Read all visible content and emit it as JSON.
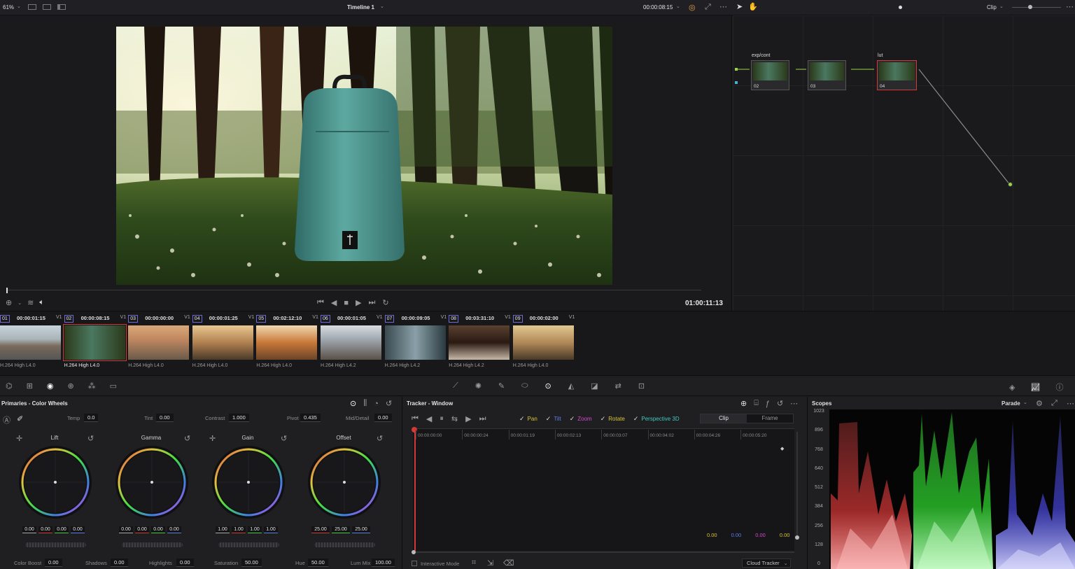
{
  "topbar": {
    "zoom": "61%",
    "timeline_name": "Timeline 1",
    "timecode": "00:00:08:15",
    "node_mode": "Clip"
  },
  "viewer": {
    "record_timecode": "01:00:11:13"
  },
  "nodes": [
    {
      "label": "exp/cont",
      "num": "02"
    },
    {
      "label": "",
      "num": "03"
    },
    {
      "label": "lut",
      "num": "04"
    }
  ],
  "clips": [
    {
      "num": "01",
      "timecode": "00:00:01:15",
      "track": "V1",
      "codec": "H.264 High L4.0"
    },
    {
      "num": "02",
      "timecode": "00:00:08:15",
      "track": "V1",
      "codec": "H.264 High L4.0"
    },
    {
      "num": "03",
      "timecode": "00:00:00:00",
      "track": "V1",
      "codec": "H.264 High L4.0"
    },
    {
      "num": "04",
      "timecode": "00:00:01:25",
      "track": "V1",
      "codec": "H.264 High L4.0"
    },
    {
      "num": "05",
      "timecode": "00:02:12:10",
      "track": "V1",
      "codec": "H.264 High L4.0"
    },
    {
      "num": "06",
      "timecode": "00:00:01:05",
      "track": "V1",
      "codec": "H.264 High L4.2"
    },
    {
      "num": "07",
      "timecode": "00:00:09:05",
      "track": "V1",
      "codec": "H.264 High L4.2"
    },
    {
      "num": "08",
      "timecode": "00:03:31:10",
      "track": "V1",
      "codec": "H.264 High L4.2"
    },
    {
      "num": "09",
      "timecode": "00:00:02:00",
      "track": "V1",
      "codec": "H.264 High L4.0"
    }
  ],
  "primaries": {
    "title": "Primaries - Color Wheels",
    "temp_label": "Temp",
    "temp": "0.0",
    "tint_label": "Tint",
    "tint": "0.00",
    "contrast_label": "Contrast",
    "contrast": "1.000",
    "pivot_label": "Pivot",
    "pivot": "0.435",
    "middetail_label": "Mid/Detail",
    "middetail": "0.00",
    "wheels": [
      {
        "name": "Lift",
        "values": [
          "0.00",
          "0.00",
          "0.00",
          "0.00"
        ]
      },
      {
        "name": "Gamma",
        "values": [
          "0.00",
          "0.00",
          "0.00",
          "0.00"
        ]
      },
      {
        "name": "Gain",
        "values": [
          "1.00",
          "1.00",
          "1.00",
          "1.00"
        ]
      },
      {
        "name": "Offset",
        "values": [
          "25.00",
          "25.00",
          "25.00"
        ]
      }
    ],
    "colorboost_label": "Color Boost",
    "colorboost": "0.00",
    "shadows_label": "Shadows",
    "shadows": "0.00",
    "highlights_label": "Highlights",
    "highlights": "0.00",
    "saturation_label": "Saturation",
    "saturation": "50.00",
    "hue_label": "Hue",
    "hue": "50.00",
    "lummix_label": "Lum Mix",
    "lummix": "100.00"
  },
  "tracker": {
    "title": "Tracker - Window",
    "pan": "Pan",
    "tilt": "Tilt",
    "zoom": "Zoom",
    "rotate": "Rotate",
    "perspective": "Perspective 3D",
    "clip_tab": "Clip",
    "frame_tab": "Frame",
    "ruler": [
      "00:00:00:00",
      "00:00:00:24",
      "00:00:01:19",
      "00:00:02:13",
      "00:00:03:07",
      "00:00:04:02",
      "00:00:04:26",
      "00:00:05:20"
    ],
    "readouts": [
      "0.00",
      "0.00",
      "0.00",
      "0.00"
    ],
    "interactive_mode": "Interactive Mode",
    "tracker_type": "Cloud Tracker"
  },
  "scopes": {
    "title": "Scopes",
    "mode": "Parade",
    "scale": [
      "1023",
      "896",
      "768",
      "640",
      "512",
      "384",
      "256",
      "128",
      "0"
    ]
  },
  "colors": {
    "accent_red": "#d23a3a",
    "accent_blue": "#5b7fe8"
  }
}
